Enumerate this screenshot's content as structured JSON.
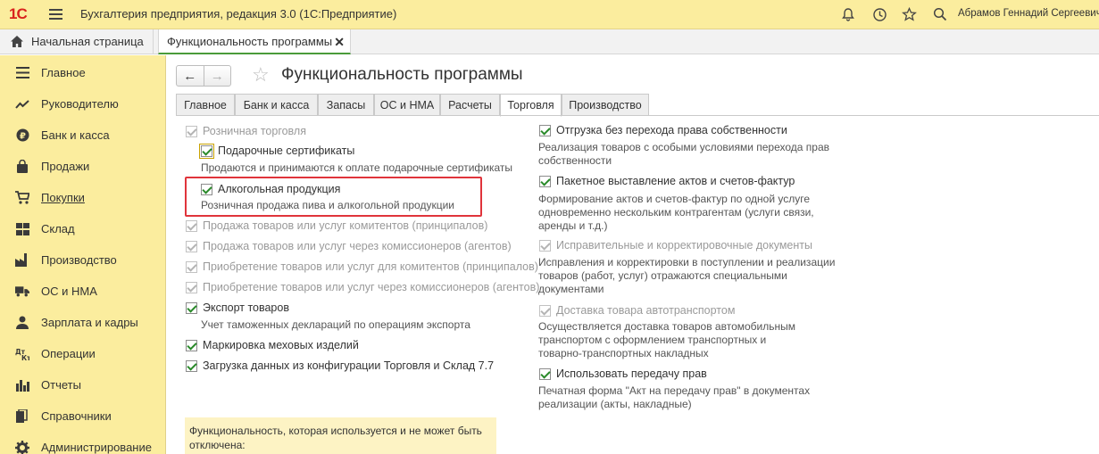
{
  "app": {
    "logo": "1С",
    "title": "Бухгалтерия предприятия, редакция 3.0  (1С:Предприятие)",
    "user": "Абрамов Геннадий Сергеевич"
  },
  "tabs": {
    "home": "Начальная страница",
    "current": "Функциональность программы",
    "close": "✕"
  },
  "sidebar": {
    "items": [
      {
        "label": "Главное",
        "icon": "menu-lines-icon"
      },
      {
        "label": "Руководителю",
        "icon": "trend-icon"
      },
      {
        "label": "Банк и касса",
        "icon": "ruble-icon"
      },
      {
        "label": "Продажи",
        "icon": "bag-icon"
      },
      {
        "label": "Покупки",
        "icon": "cart-icon"
      },
      {
        "label": "Склад",
        "icon": "warehouse-icon"
      },
      {
        "label": "Производство",
        "icon": "factory-icon"
      },
      {
        "label": "ОС и НМА",
        "icon": "truck-icon"
      },
      {
        "label": "Зарплата и кадры",
        "icon": "person-icon"
      },
      {
        "label": "Операции",
        "icon": "dt-kt-icon"
      },
      {
        "label": "Отчеты",
        "icon": "bar-chart-icon"
      },
      {
        "label": "Справочники",
        "icon": "books-icon"
      },
      {
        "label": "Администрирование",
        "icon": "gear-icon"
      }
    ]
  },
  "page": {
    "title": "Функциональность программы",
    "back": "←",
    "forward": "→",
    "star": "☆"
  },
  "form_tabs": [
    "Главное",
    "Банк и касса",
    "Запасы",
    "ОС и НМА",
    "Расчеты",
    "Торговля",
    "Производство"
  ],
  "left": {
    "retail": "Розничная торговля",
    "gift_cards": {
      "label": "Подарочные сертификаты",
      "desc": "Продаются и принимаются к оплате подарочные сертификаты"
    },
    "alcohol": {
      "label": "Алкогольная продукция",
      "desc": "Розничная продажа пива и алкогольной продукции"
    },
    "disabled_options": [
      "Продажа товаров или услуг комитентов (принципалов)",
      "Продажа товаров или услуг через комиссионеров (агентов)",
      "Приобретение товаров или услуг для комитентов (принципалов)",
      "Приобретение товаров или услуг через комиссионеров (агентов)"
    ],
    "export": {
      "label": "Экспорт товаров",
      "desc": "Учет таможенных деклараций по операциям экспорта"
    },
    "fur": {
      "label": "Маркировка меховых изделий"
    },
    "load77": {
      "label": "Загрузка данных из конфигурации Торговля и Склад 7.7"
    },
    "note": "Функциональность, которая используется и не может быть отключена:"
  },
  "right": {
    "ownership": {
      "label": "Отгрузка без перехода права собственности",
      "desc": "Реализация товаров с особыми условиями перехода прав собственности"
    },
    "batch_acts": {
      "label": "Пакетное выставление актов и счетов-фактур",
      "desc": "Формирование актов и счетов-фактур по одной услуге одновременно нескольким контрагентам (услуги связи, аренды и т.д.)"
    },
    "corrections": {
      "label": "Исправительные и корректировочные документы",
      "desc": "Исправления и корректировки в поступлении и реализации товаров (работ, услуг) отражаются специальными документами"
    },
    "delivery": {
      "label": "Доставка товара автотранспортом",
      "desc": "Осуществляется доставка товаров автомобильным транспортом с оформлением транспортных и товарно-транспортных накладных"
    },
    "transfer_act": {
      "label": "Использовать передачу прав",
      "desc": "Печатная форма \"Акт на передачу прав\" в документах реализации (акты, накладные)"
    }
  },
  "colors": {
    "topbar": "#fbed9e",
    "highlight": "#e0343b",
    "check": "#2a8a2a"
  }
}
